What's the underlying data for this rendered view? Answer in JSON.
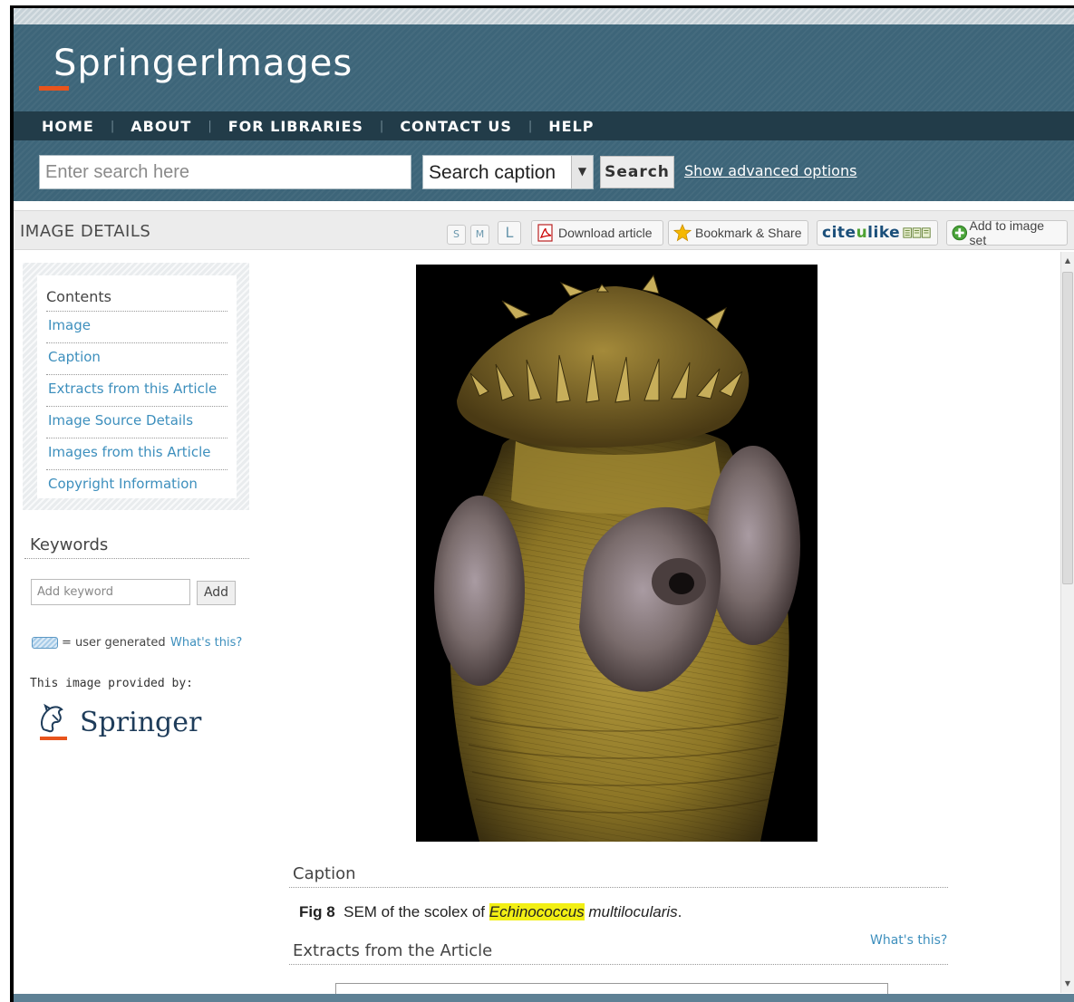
{
  "header": {
    "logo_text": "SpringerImages"
  },
  "nav": {
    "items": [
      "HOME",
      "ABOUT",
      "FOR LIBRARIES",
      "CONTACT US",
      "HELP"
    ]
  },
  "search": {
    "placeholder": "Enter search here",
    "scope_selected": "Search caption",
    "button_label": "Search",
    "advanced_link": "Show advanced options"
  },
  "details_bar": {
    "title": "IMAGE DETAILS",
    "size_small": "S",
    "size_medium": "M",
    "size_large": "L",
    "download_label": "Download article",
    "bookmark_label": "Bookmark & Share",
    "citeulike_prefix": "cite",
    "citeulike_u": "u",
    "citeulike_suffix": "like",
    "add_to_set_label": "Add to image set"
  },
  "sidebar": {
    "contents_title": "Contents",
    "contents_links": [
      "Image",
      "Caption",
      "Extracts from this Article",
      "Image Source Details",
      "Images from this Article",
      "Copyright Information"
    ],
    "keywords_title": "Keywords",
    "keyword_placeholder": "Add keyword",
    "keyword_add_label": "Add",
    "user_generated_text": "= user generated",
    "whats_this_link": "What's this?",
    "provided_by": "This image provided by:",
    "provider_name": "Springer"
  },
  "caption": {
    "title": "Caption",
    "fig_label": "Fig 8",
    "text_before": "SEM of the scolex of",
    "highlighted": "Echinococcus",
    "text_italic": "multilocularis",
    "text_after": ".",
    "whats_this": "What's this?"
  },
  "extracts": {
    "title": "Extracts from the Article"
  },
  "colors": {
    "header_bg": "#3d6579",
    "nav_bg": "#223c49",
    "link_blue": "#3d8fbd",
    "accent_orange": "#e8541c",
    "highlight_yellow": "#f2ef14"
  },
  "icons": {
    "pdf": "pdf-icon",
    "bookmark": "star-icon",
    "add": "plus-circle-icon"
  }
}
